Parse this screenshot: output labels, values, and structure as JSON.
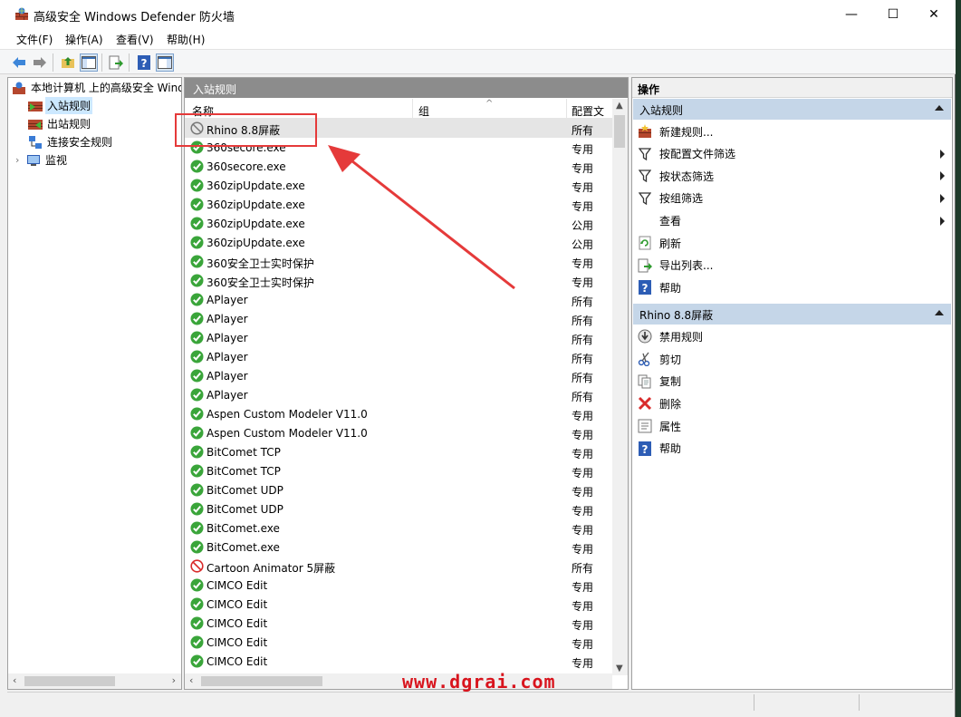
{
  "window": {
    "title": "高级安全 Windows Defender 防火墙",
    "minimize": "—",
    "maximize": "☐",
    "close": "✕"
  },
  "menu": [
    "文件(F)",
    "操作(A)",
    "查看(V)",
    "帮助(H)"
  ],
  "tree": {
    "root": "本地计算机 上的高级安全 Windows Defender 防火墙",
    "items": [
      {
        "label": "入站规则",
        "selected": true
      },
      {
        "label": "出站规则"
      },
      {
        "label": "连接安全规则"
      },
      {
        "label": "监视"
      }
    ]
  },
  "center": {
    "header": "入站规则",
    "columns": {
      "name": "名称",
      "group": "组",
      "profile": "配置文件"
    },
    "rules": [
      {
        "name": "Rhino 8.8屏蔽",
        "profile": "所有",
        "status": "block",
        "highlighted": true
      },
      {
        "name": "360secore.exe",
        "profile": "专用",
        "status": "allow"
      },
      {
        "name": "360secore.exe",
        "profile": "专用",
        "status": "allow"
      },
      {
        "name": "360zipUpdate.exe",
        "profile": "专用",
        "status": "allow"
      },
      {
        "name": "360zipUpdate.exe",
        "profile": "专用",
        "status": "allow"
      },
      {
        "name": "360zipUpdate.exe",
        "profile": "公用",
        "status": "allow"
      },
      {
        "name": "360zipUpdate.exe",
        "profile": "公用",
        "status": "allow"
      },
      {
        "name": "360安全卫士实时保护",
        "profile": "专用",
        "status": "allow"
      },
      {
        "name": "360安全卫士实时保护",
        "profile": "专用",
        "status": "allow"
      },
      {
        "name": "APlayer",
        "profile": "所有",
        "status": "allow"
      },
      {
        "name": "APlayer",
        "profile": "所有",
        "status": "allow"
      },
      {
        "name": "APlayer",
        "profile": "所有",
        "status": "allow"
      },
      {
        "name": "APlayer",
        "profile": "所有",
        "status": "allow"
      },
      {
        "name": "APlayer",
        "profile": "所有",
        "status": "allow"
      },
      {
        "name": "APlayer",
        "profile": "所有",
        "status": "allow"
      },
      {
        "name": "Aspen Custom Modeler V11.0",
        "profile": "专用",
        "status": "allow"
      },
      {
        "name": "Aspen Custom Modeler V11.0",
        "profile": "专用",
        "status": "allow"
      },
      {
        "name": "BitComet TCP",
        "profile": "专用",
        "status": "allow"
      },
      {
        "name": "BitComet TCP",
        "profile": "专用",
        "status": "allow"
      },
      {
        "name": "BitComet UDP",
        "profile": "专用",
        "status": "allow"
      },
      {
        "name": "BitComet UDP",
        "profile": "专用",
        "status": "allow"
      },
      {
        "name": "BitComet.exe",
        "profile": "专用",
        "status": "allow"
      },
      {
        "name": "BitComet.exe",
        "profile": "专用",
        "status": "allow"
      },
      {
        "name": "Cartoon Animator 5屏蔽",
        "profile": "所有",
        "status": "block-red"
      },
      {
        "name": "CIMCO Edit",
        "profile": "专用",
        "status": "allow"
      },
      {
        "name": "CIMCO Edit",
        "profile": "专用",
        "status": "allow"
      },
      {
        "name": "CIMCO Edit",
        "profile": "专用",
        "status": "allow"
      },
      {
        "name": "CIMCO Edit",
        "profile": "专用",
        "status": "allow"
      },
      {
        "name": "CIMCO Edit",
        "profile": "专用",
        "status": "allow"
      }
    ]
  },
  "actions": {
    "header": "操作",
    "section1": {
      "title": "入站规则",
      "items": [
        {
          "label": "新建规则...",
          "icon": "new-rule-icon"
        },
        {
          "label": "按配置文件筛选",
          "icon": "filter-icon",
          "submenu": true
        },
        {
          "label": "按状态筛选",
          "icon": "filter-icon",
          "submenu": true
        },
        {
          "label": "按组筛选",
          "icon": "filter-icon",
          "submenu": true
        },
        {
          "label": "查看",
          "icon": "",
          "submenu": true
        },
        {
          "label": "刷新",
          "icon": "refresh-icon"
        },
        {
          "label": "导出列表...",
          "icon": "export-icon"
        },
        {
          "label": "帮助",
          "icon": "help-icon"
        }
      ]
    },
    "section2": {
      "title": "Rhino 8.8屏蔽",
      "items": [
        {
          "label": "禁用规则",
          "icon": "disable-icon"
        },
        {
          "label": "剪切",
          "icon": "cut-icon"
        },
        {
          "label": "复制",
          "icon": "copy-icon"
        },
        {
          "label": "删除",
          "icon": "delete-icon"
        },
        {
          "label": "属性",
          "icon": "properties-icon"
        },
        {
          "label": "帮助",
          "icon": "help-icon"
        }
      ]
    }
  },
  "watermark": "www.dgrai.com",
  "colors": {
    "allow": "#3aa53a",
    "block": "#d92b2b",
    "section": "#c5d6e8",
    "pane_header": "#8c8c8c",
    "annotation": "#e53a3a"
  }
}
